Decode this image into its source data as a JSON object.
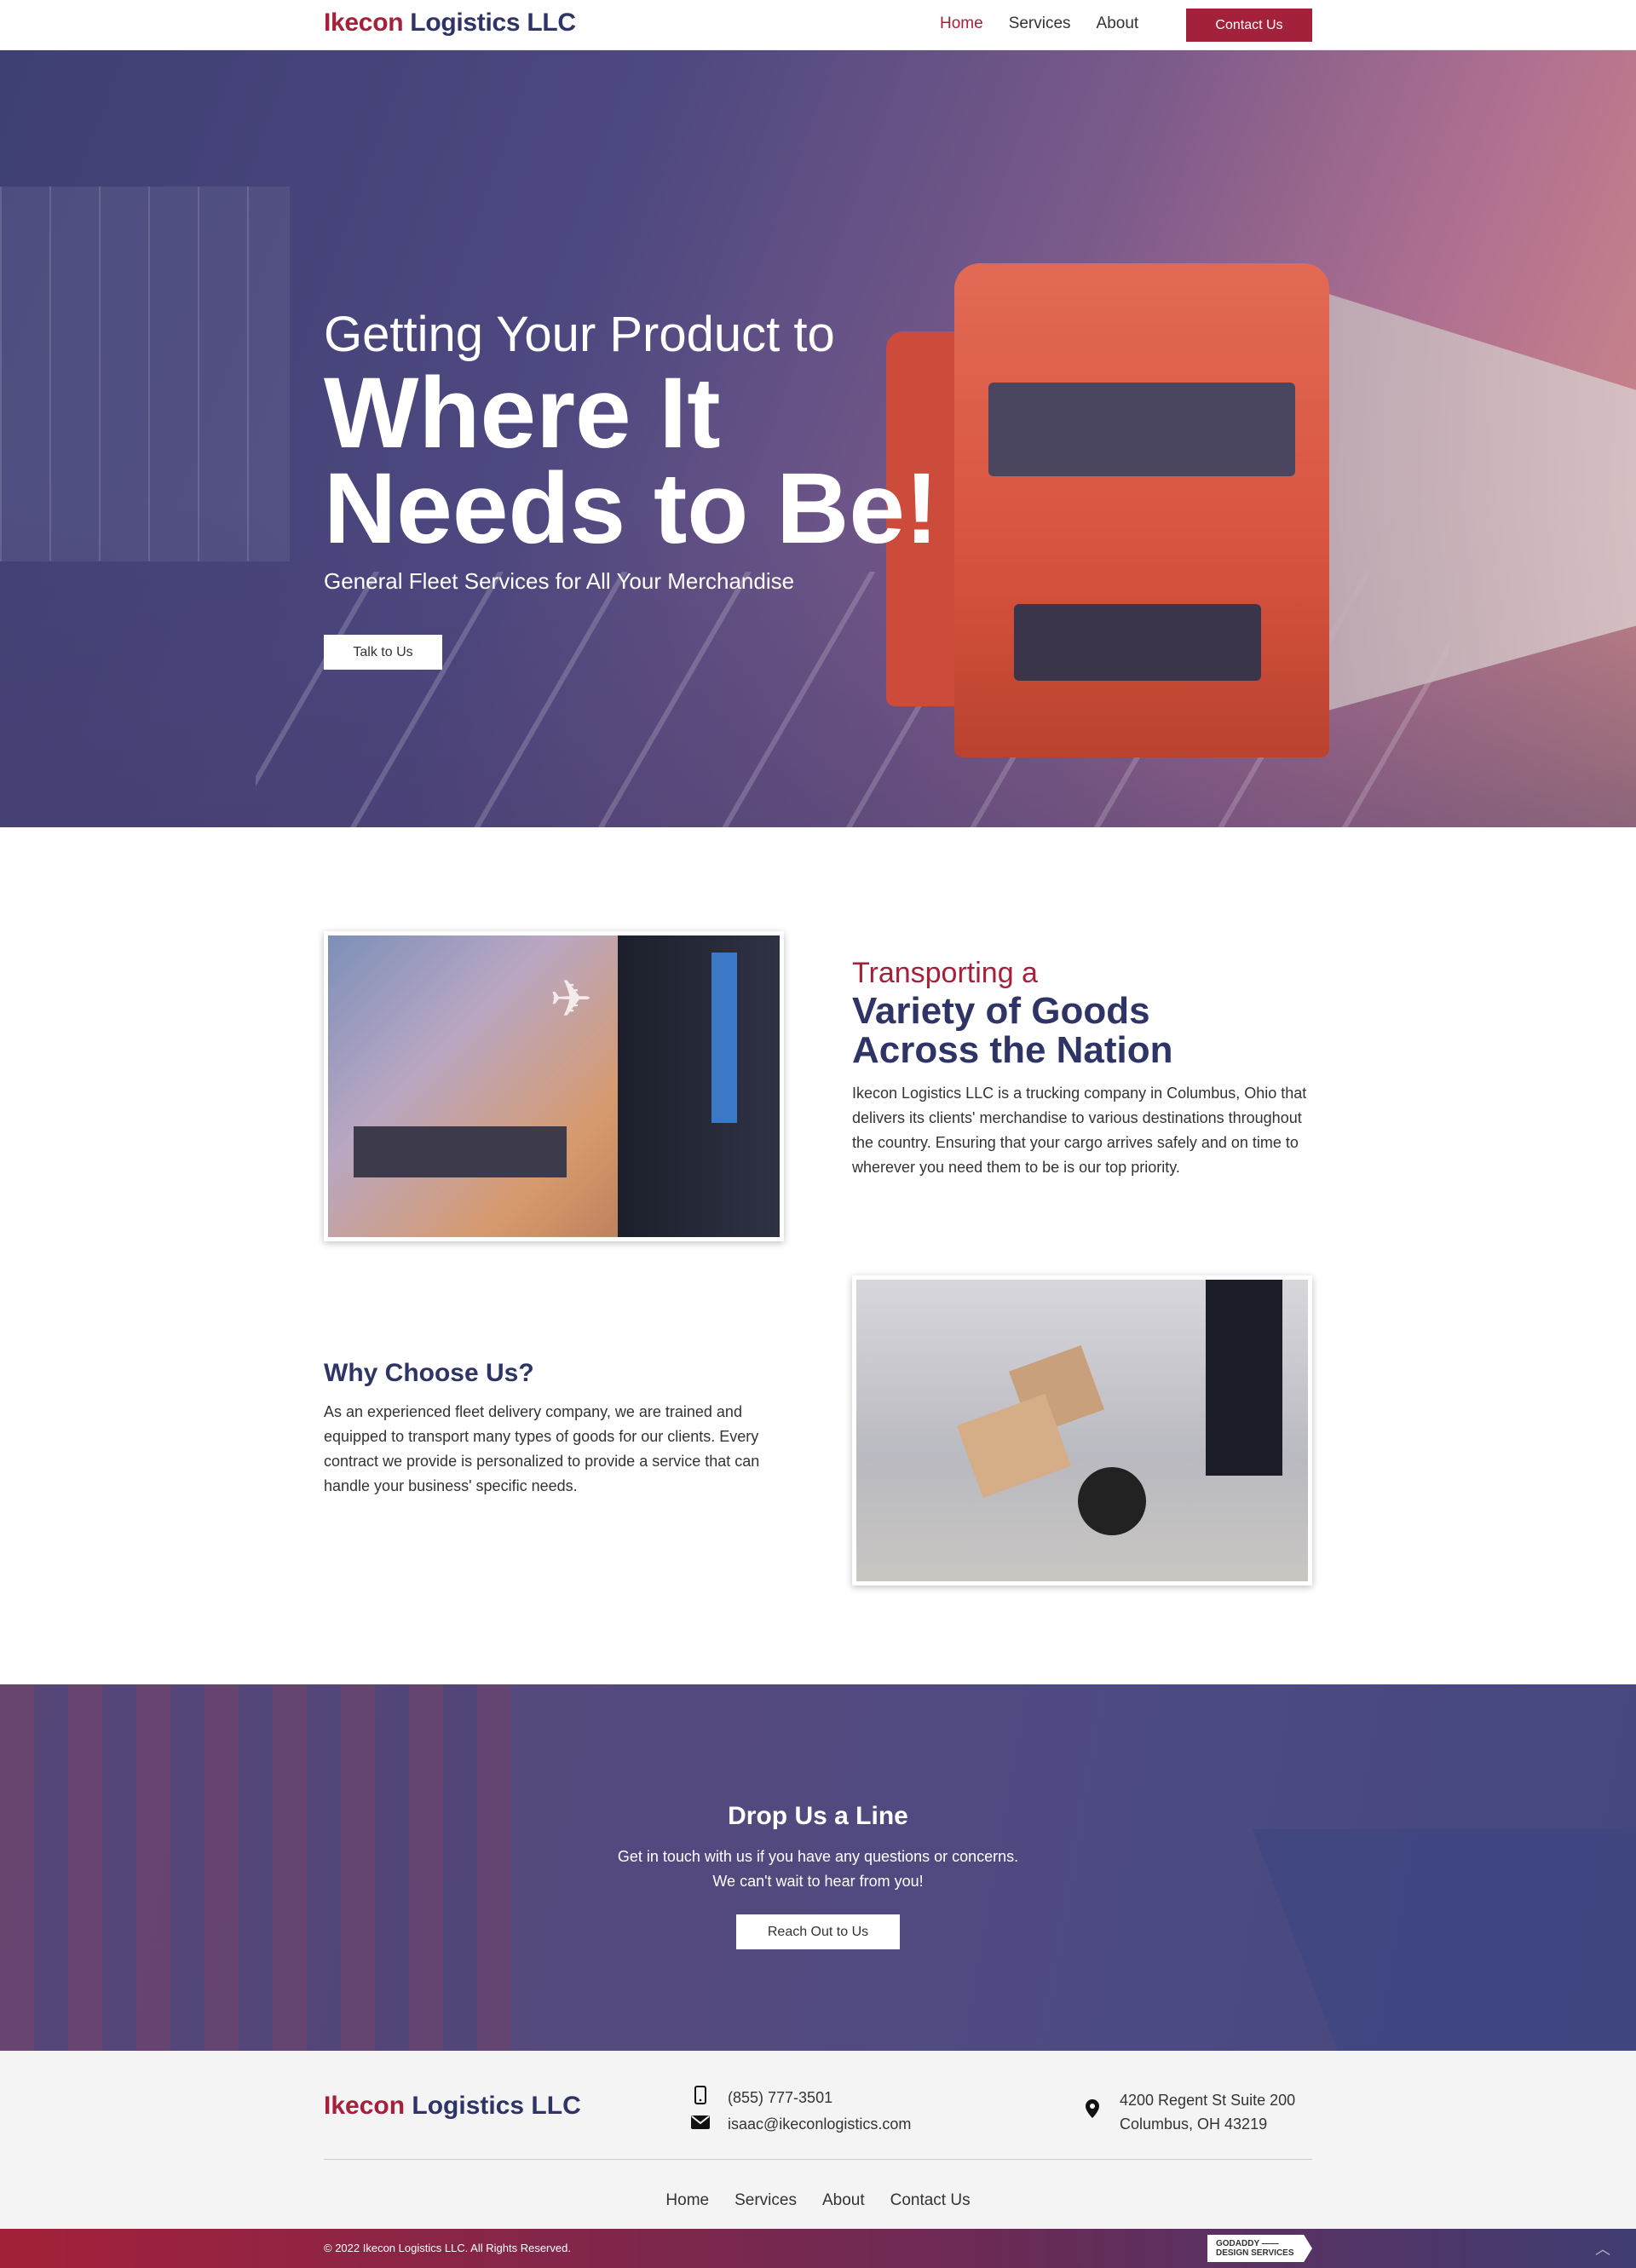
{
  "header": {
    "logo_part1": "Ikecon",
    "logo_part2": "Logistics LLC",
    "nav": [
      "Home",
      "Services",
      "About"
    ],
    "contact_button": "Contact Us"
  },
  "hero": {
    "subtitle": "Getting Your Product to",
    "title_line1": "Where It",
    "title_line2": "Needs to Be!",
    "tagline": "General Fleet Services for All Your Merchandise",
    "button": "Talk to Us"
  },
  "transport": {
    "kicker": "Transporting a",
    "title_line1": "Variety of Goods",
    "title_line2": "Across the Nation",
    "body": "Ikecon Logistics LLC is a trucking company in Columbus, Ohio that delivers its clients' merchandise to various destinations throughout the country. Ensuring that your cargo arrives safely and on time to wherever you need them to be is our top priority."
  },
  "why": {
    "title": "Why Choose Us?",
    "body": "As an experienced fleet delivery company, we are trained and equipped to transport many types of goods for our clients. Every contract we provide is personalized to provide a service that can handle your business' specific needs."
  },
  "contact_band": {
    "title": "Drop Us a Line",
    "line1": "Get in touch with us if you have any questions or concerns.",
    "line2": "We can't wait to hear from you!",
    "button": "Reach Out to Us"
  },
  "footer": {
    "logo_part1": "Ikecon",
    "logo_part2": "Logistics LLC",
    "phone": "(855) 777-3501",
    "email": "isaac@ikeconlogistics.com",
    "address_line1": "4200 Regent St Suite 200",
    "address_line2": "Columbus, OH 43219",
    "nav": [
      "Home",
      "Services",
      "About",
      "Contact Us"
    ],
    "copyright": "© 2022 Ikecon Logistics LLC. All Rights Reserved.",
    "badge_line1": "GODADDY ——",
    "badge_line2": "DESIGN SERVICES"
  },
  "colors": {
    "brand_red": "#a3213a",
    "brand_navy": "#2e3566"
  },
  "icons": [
    "phone-icon",
    "email-icon",
    "location-pin-icon",
    "scroll-up-icon"
  ]
}
